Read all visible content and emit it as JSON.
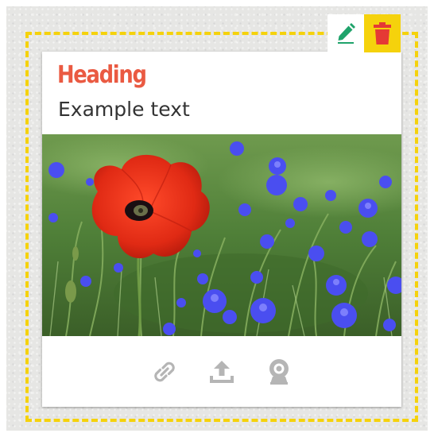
{
  "card": {
    "heading": "Heading",
    "text": "Example text",
    "image_alt": "Red poppy among blue cornflowers"
  },
  "toolbar": {
    "edit_icon": "pencil-icon",
    "delete_icon": "trash-icon"
  },
  "actions": [
    {
      "icon": "link-icon"
    },
    {
      "icon": "upload-icon"
    },
    {
      "icon": "webcam-icon"
    }
  ],
  "colors": {
    "heading": "#ea5a42",
    "selection_border": "#f5d20c",
    "delete_bg": "#f5d20c",
    "delete_icon": "#e53935",
    "edit_icon": "#1fa36b",
    "action_icons": "#b5b5b5"
  }
}
